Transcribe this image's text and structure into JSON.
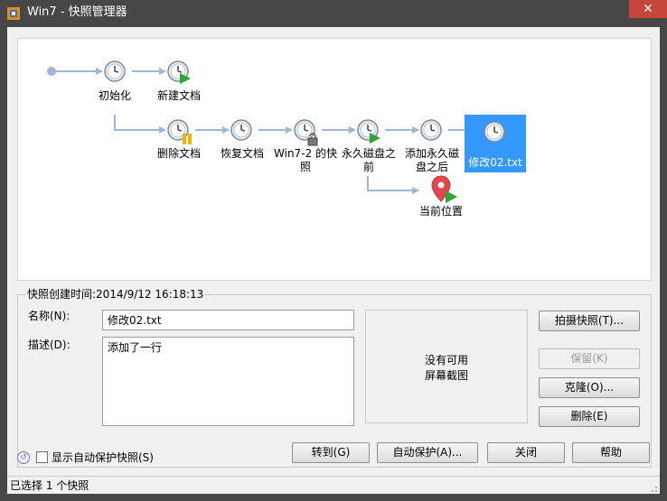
{
  "window": {
    "title": "Win7 - 快照管理器",
    "close_glyph": "✕",
    "colors": {
      "titlebar": "#474747",
      "close": "#c7463a",
      "selection": "#3399ff",
      "connector": "#9fb6d6"
    }
  },
  "tree": {
    "nodes": [
      {
        "id": "init",
        "label": "初始化",
        "label2": "",
        "icon": "snapshot-clock-icon",
        "badge": ""
      },
      {
        "id": "new-doc",
        "label": "新建文档",
        "label2": "",
        "icon": "snapshot-clock-icon",
        "badge": "play-badge"
      },
      {
        "id": "delete-doc",
        "label": "删除文档",
        "label2": "",
        "icon": "snapshot-clock-icon",
        "badge": "pause-badge"
      },
      {
        "id": "restore-doc",
        "label": "恢复文档",
        "label2": "",
        "icon": "snapshot-clock-icon",
        "badge": ""
      },
      {
        "id": "win7-2",
        "label": "Win7-2 的快",
        "label2": "照",
        "icon": "snapshot-clock-icon",
        "badge": "lock-badge"
      },
      {
        "id": "before-perm",
        "label": "永久磁盘之",
        "label2": "前",
        "icon": "snapshot-clock-icon",
        "badge": "play-badge"
      },
      {
        "id": "after-perm",
        "label": "添加永久磁",
        "label2": "盘之后",
        "icon": "snapshot-clock-icon",
        "badge": ""
      },
      {
        "id": "modify02",
        "label": "修改02.txt",
        "label2": "",
        "icon": "snapshot-clock-icon",
        "badge": ""
      },
      {
        "id": "current",
        "label": "当前位置",
        "label2": "",
        "icon": "location-pin-icon",
        "badge": "play-badge"
      }
    ],
    "selected": "modify02"
  },
  "details": {
    "group_title": "快照创建时间:2014/9/12 16:18:13",
    "name_label": "名称(N):",
    "name_value": "修改02.txt",
    "desc_label": "描述(D):",
    "desc_value": "添加了一行",
    "no_screenshot_line1": "没有可用",
    "no_screenshot_line2": "屏幕截图"
  },
  "actions": {
    "take": "拍摄快照(T)...",
    "keep": "保留(K)",
    "clone": "克隆(O)...",
    "delete": "删除(E)"
  },
  "footer": {
    "show_autoprotect": "显示自动保护快照(S)",
    "goto": "转到(G)",
    "autoprotect": "自动保护(A)...",
    "close": "关闭",
    "help": "帮助"
  },
  "status": {
    "text": "已选择 1 个快照"
  }
}
